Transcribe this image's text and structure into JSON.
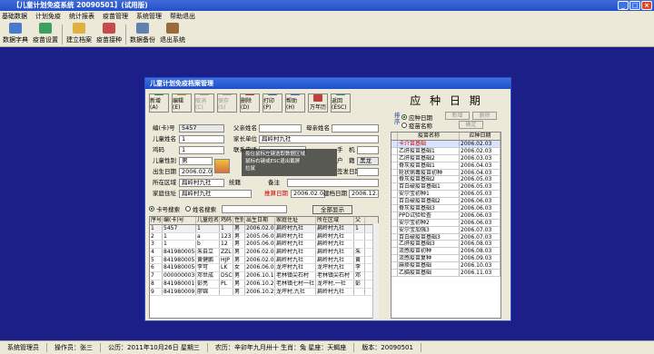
{
  "app": {
    "title": "【儿童计划免疫系统 20090501】(试用版)"
  },
  "menu": [
    "基础数据",
    "计划免疫",
    "统计报表",
    "疫苗管理",
    "系统管理",
    "帮助退出"
  ],
  "toolbar": [
    "数据字典",
    "疫苗设置",
    "建立档案",
    "疫苗接种",
    "数据备份",
    "退出系统"
  ],
  "window": {
    "title": "儿童计划免疫档案管理",
    "buttons": [
      "新增(A)",
      "编辑(E)",
      "取消(C)",
      "保存(S)",
      "删除(D)",
      "打印(P)",
      "帮助(H)",
      "万年历",
      "返回(ESC)"
    ],
    "labels": {
      "id": "编(卡)号",
      "child_name": "儿童姓名",
      "code": "鸡码",
      "gender": "儿童性别",
      "birthdate": "出生日期",
      "region": "所在区域",
      "address": "家庭住址",
      "father": "父亲姓名",
      "mother": "母亲姓名",
      "parent_unit": "家长单位",
      "contact": "联系电话",
      "phone2": "手　机",
      "hukou": "户　籍",
      "birth_place": "签发日期",
      "history": "病史",
      "note": "备注",
      "exam_date": "体检日期",
      "book_date": "建档日期"
    },
    "values": {
      "id": "5457",
      "child_name": "1",
      "code": "1",
      "gender": "男",
      "birthdate": "2006.02.03",
      "region": "扁岭村九社",
      "address": "扁岭村九社",
      "parent_unit": "扁岭村九社",
      "tonghao": "统籍",
      "hukou_val": "黑龙",
      "exam_date": "2006.02.03",
      "book_date": "2006.12.25",
      "bottom_hint": "2006.12.25"
    },
    "tooltip": [
      "按住鼠标左键选取数据区域",
      "鼠标右键或ESC退出截屏",
      "拉鼠",
      "双击"
    ],
    "vaccine_date": "推算日期"
  },
  "filter": {
    "opt1": "卡号搜索",
    "opt2": "姓名搜索",
    "show_all": "全部显示"
  },
  "table": {
    "columns": [
      "序号",
      "编(卡)号",
      "儿童姓名",
      "鸡码",
      "性别",
      "出生日期",
      "家庭住址",
      "所在区域",
      "父"
    ],
    "rows": [
      [
        "1",
        "5457",
        "1",
        "1",
        "男",
        "2006.02.03",
        "扁岭村九社",
        "扁岭村九社",
        "1"
      ],
      [
        "2",
        "1",
        "a",
        "123",
        "男",
        "2005.06.07",
        "扁岭村九社",
        "扁岭村九社",
        ""
      ],
      [
        "3",
        "1",
        "b",
        "12",
        "男",
        "2005.06.07",
        "扁岭村九社",
        "扁岭村九社",
        ""
      ],
      [
        "4",
        "8419800054",
        "朱自立",
        "ZZL",
        "男",
        "2006.02.03",
        "扁岭村九社",
        "扁岭村九社",
        "朱"
      ],
      [
        "5",
        "8419800055",
        "黄健鹏",
        "HJP",
        "男",
        "2006.02.03",
        "扁岭村九社",
        "扁岭村九社",
        "黄"
      ],
      [
        "6",
        "8419800056",
        "李可",
        "LK",
        "女",
        "2006.06.07",
        "龙坪村九社",
        "龙坪村九社",
        "李"
      ],
      [
        "7",
        "0000000030",
        "邓世成",
        "DSC",
        "男",
        "2006.10.16",
        "老林镇尖石村",
        "老林镇尖石村",
        "邓"
      ],
      [
        "8",
        "8419800019",
        "彭亮",
        "PL",
        "男",
        "2006.10.25",
        "老林镇七村一社",
        "龙坪村,一社",
        "彭"
      ],
      [
        "9",
        "8419800091",
        "廖锦",
        "",
        "男",
        "2006.10.25",
        "龙坪村,九社",
        "扁岭村九社",
        ""
      ]
    ]
  },
  "vaccine_panel": {
    "heading": "应 种 日 期",
    "side_label": "排序",
    "sort_opt1": "应种日期",
    "sort_opt2": "疫苗名称",
    "btn_add": "新增",
    "btn_del": "删除",
    "btn_ok": "确定",
    "columns": [
      "疫苗名称",
      "应种日期"
    ],
    "rows": [
      [
        "卡介苗基础",
        "2006.02.03"
      ],
      [
        "乙肝疫苗基础1",
        "2006.02.03"
      ],
      [
        "乙肝疫苗基础2",
        "2006.03.03"
      ],
      [
        "脊灰疫苗基础1",
        "2006.04.03"
      ],
      [
        "轮状病毒疫苗初种",
        "2006.04.03"
      ],
      [
        "脊灰疫苗基础2",
        "2006.05.03"
      ],
      [
        "百白破疫苗基础1",
        "2006.05.03"
      ],
      [
        "安尔宝初种1",
        "2006.05.03"
      ],
      [
        "百白破疫苗基础2",
        "2006.06.03"
      ],
      [
        "脊灰疫苗基础3",
        "2006.06.03"
      ],
      [
        "PPD试验检查",
        "2006.06.03"
      ],
      [
        "安尔宝初种2",
        "2006.06.03"
      ],
      [
        "安尔宝加强3",
        "2006.07.03"
      ],
      [
        "百白破疫苗基础3",
        "2006.07.03"
      ],
      [
        "乙肝疫苗基础3",
        "2006.08.03"
      ],
      [
        "流感疫苗初种",
        "2006.08.03"
      ],
      [
        "流感疫苗复种",
        "2006.09.03"
      ],
      [
        "麻疹疫苗基础",
        "2006.10.03"
      ],
      [
        "乙脑疫苗基础",
        "2006.11.03"
      ]
    ]
  },
  "status": [
    "系统管理员",
    "操作员：张三",
    "公历：2011年10月26日 星期三",
    "农历：辛卯年九月卅十 生肖：兔 星座：天蝎座",
    "版本：20090501"
  ]
}
